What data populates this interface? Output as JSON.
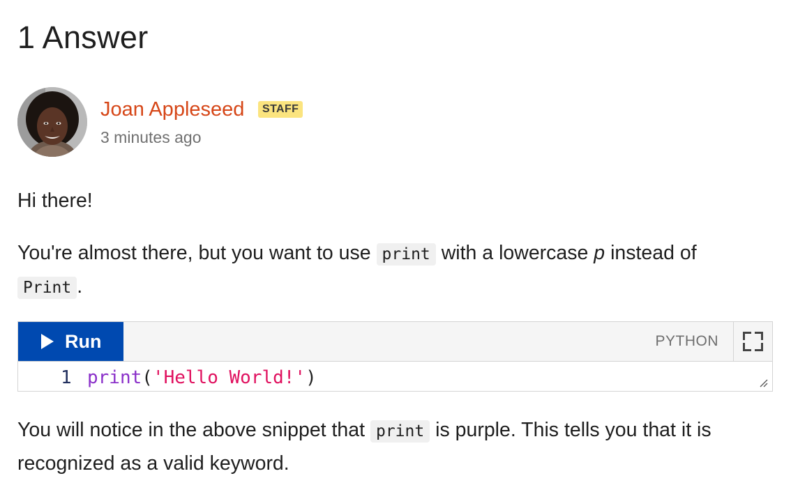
{
  "heading": "1 Answer",
  "author": {
    "name": "Joan Appleseed",
    "badge": "STAFF",
    "timestamp": "3 minutes ago",
    "avatar_icon": "person-photo"
  },
  "answer": {
    "greeting": "Hi there!",
    "para2_part1": "You're almost there, but you want to use ",
    "para2_code1": "print",
    "para2_part2": " with a lowercase ",
    "para2_emph": "p",
    "para2_part3": " instead of ",
    "para2_code2": "Print",
    "para2_part4": ".",
    "para3_part1": "You will notice in the above snippet that ",
    "para3_code": "print",
    "para3_part2": " is purple. This tells you that it is recognized as a valid keyword."
  },
  "editor": {
    "run_label": "Run",
    "language": "PYTHON",
    "line_number": "1",
    "tokens": {
      "keyword": "print",
      "open": "(",
      "string": "'Hello World!'",
      "close": ")"
    },
    "colors": {
      "run_button": "#0049b0",
      "keyword": "#8a2fc9",
      "string": "#e0115f",
      "author_name": "#d64617",
      "badge": "#fbe47f"
    }
  }
}
